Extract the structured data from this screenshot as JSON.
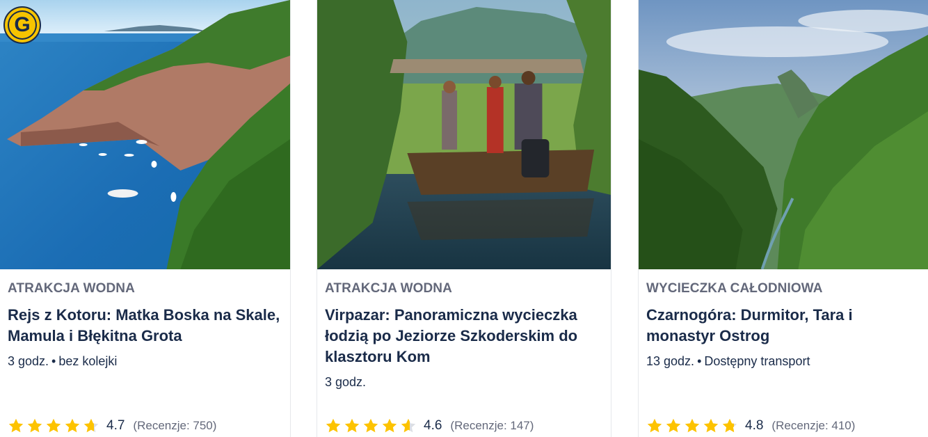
{
  "cards": [
    {
      "category": "ATRAKCJA WODNA",
      "title": "Rejs z Kotoru: Matka Boska na Skale, Mamula i Błękitna Grota",
      "duration": "3 godz.",
      "extra": "bez kolejki",
      "rating": "4.7",
      "rating_fraction": 0.94,
      "reviews": "(Recenzje: 750)",
      "badge": "G"
    },
    {
      "category": "ATRAKCJA WODNA",
      "title": "Virpazar: Panoramiczna wycieczka łodzią po Jeziorze Szkoderskim do klasztoru Kom",
      "duration": "3 godz.",
      "rating": "4.6",
      "rating_fraction": 0.92,
      "reviews": "(Recenzje: 147)"
    },
    {
      "category": "WYCIECZKA CAŁODNIOWA",
      "title": "Czarnogóra: Durmitor, Tara i monastyr Ostrog",
      "duration": "13 godz.",
      "extra": "Dostępny transport",
      "rating": "4.8",
      "rating_fraction": 0.96,
      "reviews": "(Recenzje: 410)"
    }
  ],
  "colors": {
    "star": "#fdc300",
    "star_empty": "#dcdfe4",
    "text": "#1a2b49",
    "muted": "#63687a"
  }
}
